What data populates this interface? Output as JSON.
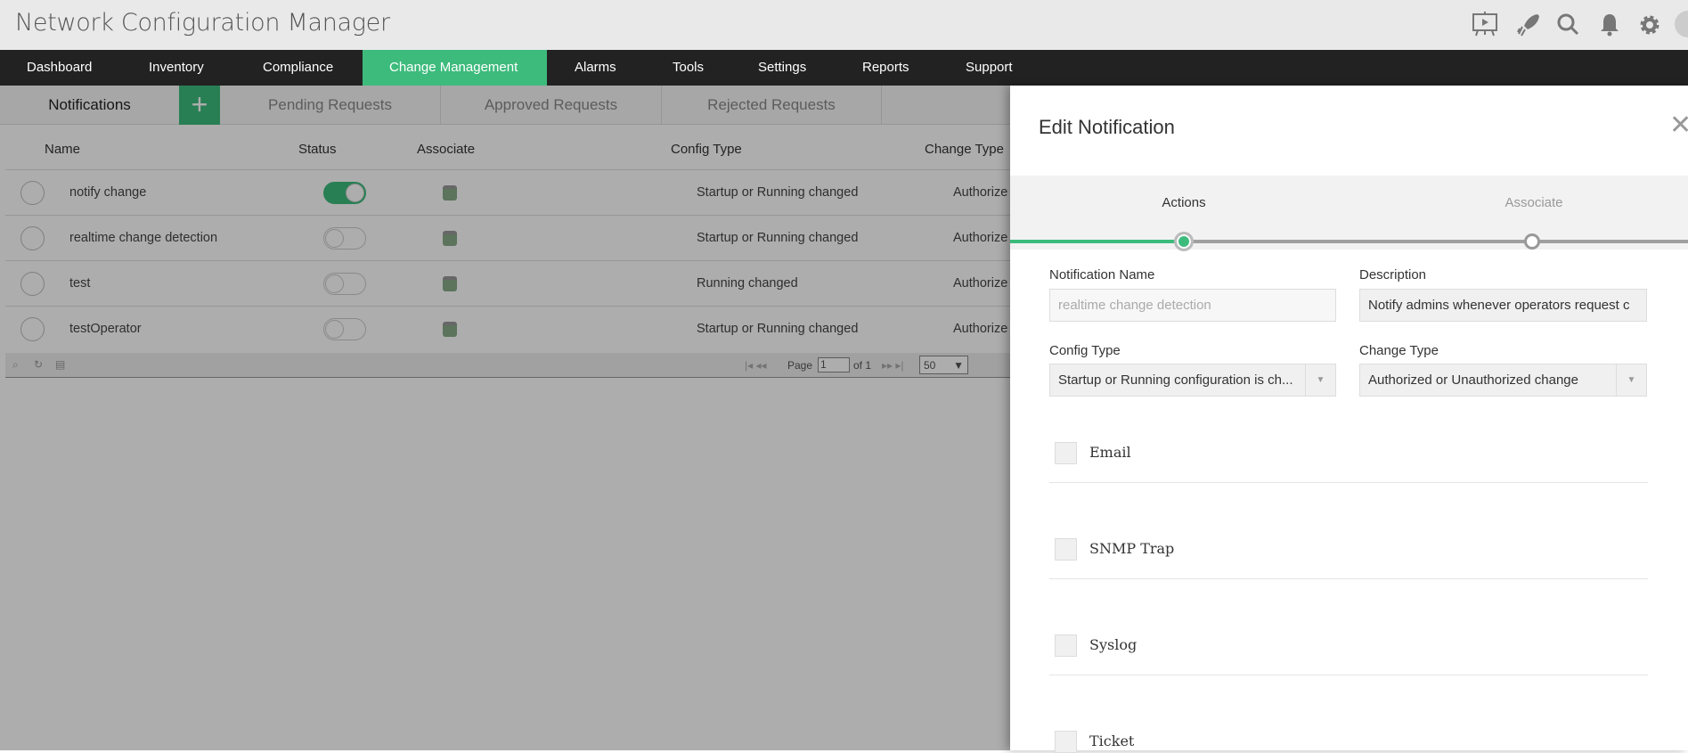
{
  "app_title": "Network Configuration Manager",
  "header_icons": [
    "presentation-icon",
    "rocket-icon",
    "search-icon",
    "bell-icon",
    "gear-icon",
    "user-avatar-icon"
  ],
  "nav": [
    {
      "label": "Dashboard"
    },
    {
      "label": "Inventory"
    },
    {
      "label": "Compliance"
    },
    {
      "label": "Change Management",
      "active": true
    },
    {
      "label": "Alarms"
    },
    {
      "label": "Tools"
    },
    {
      "label": "Settings"
    },
    {
      "label": "Reports"
    },
    {
      "label": "Support"
    }
  ],
  "subtabs": [
    "Notifications",
    "Pending Requests",
    "Approved Requests",
    "Rejected Requests"
  ],
  "add_label": "+",
  "grid": {
    "columns": [
      "Name",
      "Status",
      "Associate",
      "Config Type",
      "Change Type"
    ],
    "rows": [
      {
        "name": "notify change",
        "enabled": true,
        "config_type": "Startup or Running changed",
        "change_type": "Authorize"
      },
      {
        "name": "realtime change detection",
        "enabled": false,
        "config_type": "Startup or Running changed",
        "change_type": "Authorize"
      },
      {
        "name": "test",
        "enabled": false,
        "config_type": "Running changed",
        "change_type": "Authorize"
      },
      {
        "name": "testOperator",
        "enabled": false,
        "config_type": "Startup or Running changed",
        "change_type": "Authorize"
      }
    ],
    "pager": {
      "page_label": "Page",
      "page": "1",
      "of_label": "of 1",
      "page_size": "50"
    }
  },
  "panel": {
    "title": "Edit Notification",
    "steps": [
      {
        "label": "Actions",
        "active": true
      },
      {
        "label": "Associate",
        "active": false
      }
    ],
    "notification_name_label": "Notification Name",
    "notification_name_value": "realtime change detection",
    "description_label": "Description",
    "description_value": "Notify admins whenever operators request c",
    "config_type_label": "Config Type",
    "config_type_value": "Startup or Running configuration is ch...",
    "change_type_label": "Change Type",
    "change_type_value": "Authorized or Unauthorized change",
    "actions": [
      {
        "label": "Email",
        "checked": false
      },
      {
        "label": "SNMP Trap",
        "checked": false
      },
      {
        "label": "Syslog",
        "checked": false
      },
      {
        "label": "Ticket",
        "checked": false
      }
    ]
  },
  "colors": {
    "accent": "#3dbb7c",
    "nav_bg": "#222222"
  }
}
